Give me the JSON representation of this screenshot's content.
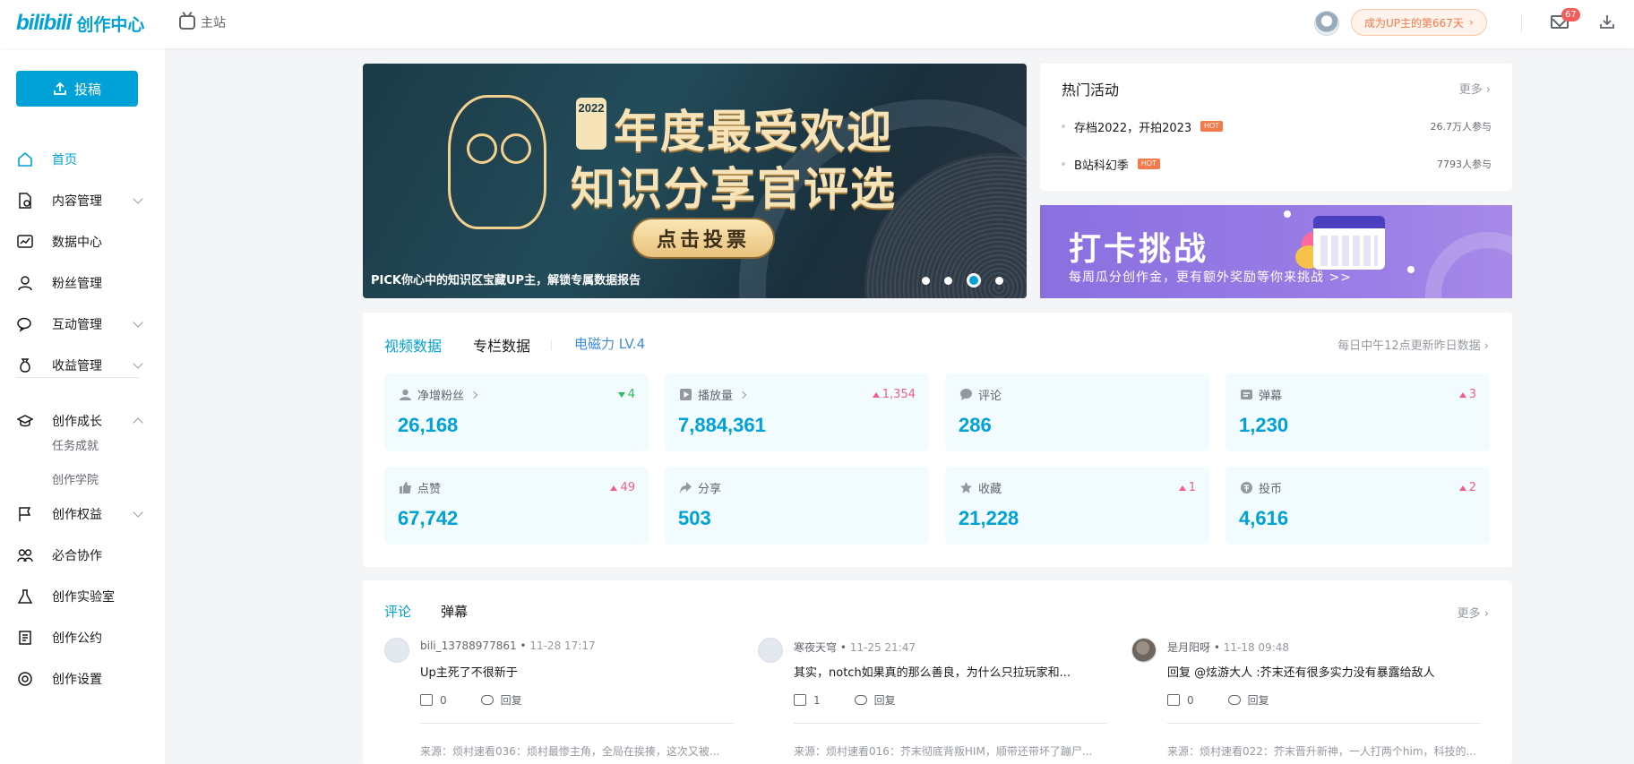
{
  "header": {
    "logo_mark": "bilibili",
    "logo_text": "创作中心",
    "home_label": "主站",
    "up_days_label": "成为UP主的第667天",
    "mail_badge": "67"
  },
  "sidebar": {
    "upload_label": "投稿",
    "items": [
      {
        "label": "首页"
      },
      {
        "label": "内容管理"
      },
      {
        "label": "数据中心"
      },
      {
        "label": "粉丝管理"
      },
      {
        "label": "互动管理"
      },
      {
        "label": "收益管理"
      },
      {
        "label": "创作成长"
      },
      {
        "label": "任务成就"
      },
      {
        "label": "创作学院"
      },
      {
        "label": "创作权益"
      },
      {
        "label": "必合协作"
      },
      {
        "label": "创作实验室"
      },
      {
        "label": "创作公约"
      },
      {
        "label": "创作设置"
      }
    ]
  },
  "banner": {
    "year": "2022",
    "title_line1": "年度最受欢迎",
    "title_line2": "知识分享官评选",
    "button": "点击投票",
    "caption": "PICK你心中的知识区宝藏UP主，解锁专属数据报告"
  },
  "hot_activities": {
    "title": "热门活动",
    "more": "更多",
    "items": [
      {
        "name": "存档2022，开拍2023",
        "tag": "HOT",
        "count": "26.7万人参与"
      },
      {
        "name": "B站科幻季",
        "tag": "HOT",
        "count": "7793人参与"
      }
    ]
  },
  "punch_banner": {
    "title": "打卡挑战",
    "subtitle": "每周瓜分创作金，更有额外奖励等你来挑战 >>"
  },
  "data_panel": {
    "tabs": [
      "视频数据",
      "专栏数据"
    ],
    "level": "电磁力 LV.4",
    "update_note": "每日中午12点更新昨日数据",
    "cards": [
      {
        "label": "净增粉丝",
        "value": "26,168",
        "delta": "4",
        "direction": "down",
        "icon": "user-icon"
      },
      {
        "label": "播放量",
        "value": "7,884,361",
        "delta": "1,354",
        "direction": "up",
        "icon": "play-icon"
      },
      {
        "label": "评论",
        "value": "286",
        "delta": "",
        "direction": "none",
        "icon": "comment-icon"
      },
      {
        "label": "弹幕",
        "value": "1,230",
        "delta": "3",
        "direction": "up",
        "icon": "danmaku-icon"
      },
      {
        "label": "点赞",
        "value": "67,742",
        "delta": "49",
        "direction": "up",
        "icon": "like-icon"
      },
      {
        "label": "分享",
        "value": "503",
        "delta": "",
        "direction": "none",
        "icon": "share-icon"
      },
      {
        "label": "收藏",
        "value": "21,228",
        "delta": "1",
        "direction": "up",
        "icon": "star-icon"
      },
      {
        "label": "投币",
        "value": "4,616",
        "delta": "2",
        "direction": "up",
        "icon": "coin-icon"
      }
    ]
  },
  "comments": {
    "tabs": [
      "评论",
      "弹幕"
    ],
    "more": "更多",
    "reply_label": "回复",
    "items": [
      {
        "user": "bili_13788977861",
        "time": "11-28 17:17",
        "text": "Up主死了不很新于",
        "likes": "0",
        "source": "来源：烦村速看036：烦村最惨主角，全局在挨揍，这次又被..."
      },
      {
        "user": "寒夜天穹",
        "time": "11-25 21:47",
        "text": "其实，notch如果真的那么善良，为什么只拉玩家和...",
        "likes": "1",
        "source": "来源：烦村速看016：芥末彻底背叛HIM，顺带还带坏了蹦尸..."
      },
      {
        "user": "是月阳呀",
        "time": "11-18 09:48",
        "text": "回复 @炫游大人 :芥末还有很多实力没有暴露给敌人",
        "likes": "0",
        "source": "来源：烦村速看022：芥末晋升新神，一人打两个him，科技的..."
      }
    ]
  },
  "colors": {
    "accent": "#00a1d6",
    "up_red": "#f25d8e",
    "down_green": "#2ebd59",
    "hot_orange": "#f6794a"
  }
}
